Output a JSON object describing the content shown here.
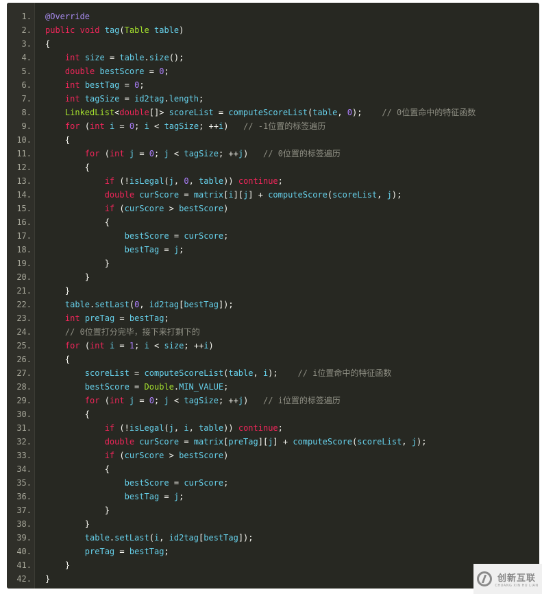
{
  "code": {
    "language": "java",
    "lines": [
      [
        [
          "an",
          "@Override"
        ]
      ],
      [
        [
          "kw",
          "public"
        ],
        [
          "p",
          " "
        ],
        [
          "kw",
          "void"
        ],
        [
          "p",
          " "
        ],
        [
          "id",
          "tag"
        ],
        [
          "p",
          "("
        ],
        [
          "ty",
          "Table"
        ],
        [
          "p",
          " "
        ],
        [
          "id",
          "table"
        ],
        [
          "p",
          ")"
        ]
      ],
      [
        [
          "p",
          "{"
        ]
      ],
      [
        [
          "p",
          "    "
        ],
        [
          "kw",
          "int"
        ],
        [
          "p",
          " "
        ],
        [
          "id",
          "size"
        ],
        [
          "p",
          " = "
        ],
        [
          "id",
          "table"
        ],
        [
          "p",
          "."
        ],
        [
          "id",
          "size"
        ],
        [
          "p",
          "();"
        ]
      ],
      [
        [
          "p",
          "    "
        ],
        [
          "kw",
          "double"
        ],
        [
          "p",
          " "
        ],
        [
          "id",
          "bestScore"
        ],
        [
          "p",
          " = "
        ],
        [
          "num",
          "0"
        ],
        [
          "p",
          ";"
        ]
      ],
      [
        [
          "p",
          "    "
        ],
        [
          "kw",
          "int"
        ],
        [
          "p",
          " "
        ],
        [
          "id",
          "bestTag"
        ],
        [
          "p",
          " = "
        ],
        [
          "num",
          "0"
        ],
        [
          "p",
          ";"
        ]
      ],
      [
        [
          "p",
          "    "
        ],
        [
          "kw",
          "int"
        ],
        [
          "p",
          " "
        ],
        [
          "id",
          "tagSize"
        ],
        [
          "p",
          " = "
        ],
        [
          "id",
          "id2tag"
        ],
        [
          "p",
          "."
        ],
        [
          "id",
          "length"
        ],
        [
          "p",
          ";"
        ]
      ],
      [
        [
          "p",
          "    "
        ],
        [
          "ty",
          "LinkedList"
        ],
        [
          "p",
          "<"
        ],
        [
          "kw",
          "double"
        ],
        [
          "p",
          "[]> "
        ],
        [
          "id",
          "scoreList"
        ],
        [
          "p",
          " = "
        ],
        [
          "id",
          "computeScoreList"
        ],
        [
          "p",
          "("
        ],
        [
          "id",
          "table"
        ],
        [
          "p",
          ", "
        ],
        [
          "num",
          "0"
        ],
        [
          "p",
          ");    "
        ],
        [
          "cm",
          "// 0位置命中的特征函数"
        ]
      ],
      [
        [
          "p",
          "    "
        ],
        [
          "kw",
          "for"
        ],
        [
          "p",
          " ("
        ],
        [
          "kw",
          "int"
        ],
        [
          "p",
          " "
        ],
        [
          "id",
          "i"
        ],
        [
          "p",
          " = "
        ],
        [
          "num",
          "0"
        ],
        [
          "p",
          "; "
        ],
        [
          "id",
          "i"
        ],
        [
          "p",
          " < "
        ],
        [
          "id",
          "tagSize"
        ],
        [
          "p",
          "; ++"
        ],
        [
          "id",
          "i"
        ],
        [
          "p",
          ")   "
        ],
        [
          "cm",
          "// -1位置的标签遍历"
        ]
      ],
      [
        [
          "p",
          "    {"
        ]
      ],
      [
        [
          "p",
          "        "
        ],
        [
          "kw",
          "for"
        ],
        [
          "p",
          " ("
        ],
        [
          "kw",
          "int"
        ],
        [
          "p",
          " "
        ],
        [
          "id",
          "j"
        ],
        [
          "p",
          " = "
        ],
        [
          "num",
          "0"
        ],
        [
          "p",
          "; "
        ],
        [
          "id",
          "j"
        ],
        [
          "p",
          " < "
        ],
        [
          "id",
          "tagSize"
        ],
        [
          "p",
          "; ++"
        ],
        [
          "id",
          "j"
        ],
        [
          "p",
          ")   "
        ],
        [
          "cm",
          "// 0位置的标签遍历"
        ]
      ],
      [
        [
          "p",
          "        {"
        ]
      ],
      [
        [
          "p",
          "            "
        ],
        [
          "kw",
          "if"
        ],
        [
          "p",
          " (!"
        ],
        [
          "id",
          "isLegal"
        ],
        [
          "p",
          "("
        ],
        [
          "id",
          "j"
        ],
        [
          "p",
          ", "
        ],
        [
          "num",
          "0"
        ],
        [
          "p",
          ", "
        ],
        [
          "id",
          "table"
        ],
        [
          "p",
          ")) "
        ],
        [
          "kw",
          "continue"
        ],
        [
          "p",
          ";"
        ]
      ],
      [
        [
          "p",
          "            "
        ],
        [
          "kw",
          "double"
        ],
        [
          "p",
          " "
        ],
        [
          "id",
          "curScore"
        ],
        [
          "p",
          " = "
        ],
        [
          "id",
          "matrix"
        ],
        [
          "p",
          "["
        ],
        [
          "id",
          "i"
        ],
        [
          "p",
          "]["
        ],
        [
          "id",
          "j"
        ],
        [
          "p",
          "] + "
        ],
        [
          "id",
          "computeScore"
        ],
        [
          "p",
          "("
        ],
        [
          "id",
          "scoreList"
        ],
        [
          "p",
          ", "
        ],
        [
          "id",
          "j"
        ],
        [
          "p",
          ");"
        ]
      ],
      [
        [
          "p",
          "            "
        ],
        [
          "kw",
          "if"
        ],
        [
          "p",
          " ("
        ],
        [
          "id",
          "curScore"
        ],
        [
          "p",
          " > "
        ],
        [
          "id",
          "bestScore"
        ],
        [
          "p",
          ")"
        ]
      ],
      [
        [
          "p",
          "            {"
        ]
      ],
      [
        [
          "p",
          "                "
        ],
        [
          "id",
          "bestScore"
        ],
        [
          "p",
          " = "
        ],
        [
          "id",
          "curScore"
        ],
        [
          "p",
          ";"
        ]
      ],
      [
        [
          "p",
          "                "
        ],
        [
          "id",
          "bestTag"
        ],
        [
          "p",
          " = "
        ],
        [
          "id",
          "j"
        ],
        [
          "p",
          ";"
        ]
      ],
      [
        [
          "p",
          "            }"
        ]
      ],
      [
        [
          "p",
          "        }"
        ]
      ],
      [
        [
          "p",
          "    }"
        ]
      ],
      [
        [
          "p",
          "    "
        ],
        [
          "id",
          "table"
        ],
        [
          "p",
          "."
        ],
        [
          "id",
          "setLast"
        ],
        [
          "p",
          "("
        ],
        [
          "num",
          "0"
        ],
        [
          "p",
          ", "
        ],
        [
          "id",
          "id2tag"
        ],
        [
          "p",
          "["
        ],
        [
          "id",
          "bestTag"
        ],
        [
          "p",
          "]);"
        ]
      ],
      [
        [
          "p",
          "    "
        ],
        [
          "kw",
          "int"
        ],
        [
          "p",
          " "
        ],
        [
          "id",
          "preTag"
        ],
        [
          "p",
          " = "
        ],
        [
          "id",
          "bestTag"
        ],
        [
          "p",
          ";"
        ]
      ],
      [
        [
          "p",
          "    "
        ],
        [
          "cm",
          "// 0位置打分完毕，接下来打剩下的"
        ]
      ],
      [
        [
          "p",
          "    "
        ],
        [
          "kw",
          "for"
        ],
        [
          "p",
          " ("
        ],
        [
          "kw",
          "int"
        ],
        [
          "p",
          " "
        ],
        [
          "id",
          "i"
        ],
        [
          "p",
          " = "
        ],
        [
          "num",
          "1"
        ],
        [
          "p",
          "; "
        ],
        [
          "id",
          "i"
        ],
        [
          "p",
          " < "
        ],
        [
          "id",
          "size"
        ],
        [
          "p",
          "; ++"
        ],
        [
          "id",
          "i"
        ],
        [
          "p",
          ")"
        ]
      ],
      [
        [
          "p",
          "    {"
        ]
      ],
      [
        [
          "p",
          "        "
        ],
        [
          "id",
          "scoreList"
        ],
        [
          "p",
          " = "
        ],
        [
          "id",
          "computeScoreList"
        ],
        [
          "p",
          "("
        ],
        [
          "id",
          "table"
        ],
        [
          "p",
          ", "
        ],
        [
          "id",
          "i"
        ],
        [
          "p",
          ");    "
        ],
        [
          "cm",
          "// i位置命中的特征函数"
        ]
      ],
      [
        [
          "p",
          "        "
        ],
        [
          "id",
          "bestScore"
        ],
        [
          "p",
          " = "
        ],
        [
          "ty",
          "Double"
        ],
        [
          "p",
          "."
        ],
        [
          "id",
          "MIN_VALUE"
        ],
        [
          "p",
          ";"
        ]
      ],
      [
        [
          "p",
          "        "
        ],
        [
          "kw",
          "for"
        ],
        [
          "p",
          " ("
        ],
        [
          "kw",
          "int"
        ],
        [
          "p",
          " "
        ],
        [
          "id",
          "j"
        ],
        [
          "p",
          " = "
        ],
        [
          "num",
          "0"
        ],
        [
          "p",
          "; "
        ],
        [
          "id",
          "j"
        ],
        [
          "p",
          " < "
        ],
        [
          "id",
          "tagSize"
        ],
        [
          "p",
          "; ++"
        ],
        [
          "id",
          "j"
        ],
        [
          "p",
          ")   "
        ],
        [
          "cm",
          "// i位置的标签遍历"
        ]
      ],
      [
        [
          "p",
          "        {"
        ]
      ],
      [
        [
          "p",
          "            "
        ],
        [
          "kw",
          "if"
        ],
        [
          "p",
          " (!"
        ],
        [
          "id",
          "isLegal"
        ],
        [
          "p",
          "("
        ],
        [
          "id",
          "j"
        ],
        [
          "p",
          ", "
        ],
        [
          "id",
          "i"
        ],
        [
          "p",
          ", "
        ],
        [
          "id",
          "table"
        ],
        [
          "p",
          ")) "
        ],
        [
          "kw",
          "continue"
        ],
        [
          "p",
          ";"
        ]
      ],
      [
        [
          "p",
          "            "
        ],
        [
          "kw",
          "double"
        ],
        [
          "p",
          " "
        ],
        [
          "id",
          "curScore"
        ],
        [
          "p",
          " = "
        ],
        [
          "id",
          "matrix"
        ],
        [
          "p",
          "["
        ],
        [
          "id",
          "preTag"
        ],
        [
          "p",
          "]["
        ],
        [
          "id",
          "j"
        ],
        [
          "p",
          "] + "
        ],
        [
          "id",
          "computeScore"
        ],
        [
          "p",
          "("
        ],
        [
          "id",
          "scoreList"
        ],
        [
          "p",
          ", "
        ],
        [
          "id",
          "j"
        ],
        [
          "p",
          ");"
        ]
      ],
      [
        [
          "p",
          "            "
        ],
        [
          "kw",
          "if"
        ],
        [
          "p",
          " ("
        ],
        [
          "id",
          "curScore"
        ],
        [
          "p",
          " > "
        ],
        [
          "id",
          "bestScore"
        ],
        [
          "p",
          ")"
        ]
      ],
      [
        [
          "p",
          "            {"
        ]
      ],
      [
        [
          "p",
          "                "
        ],
        [
          "id",
          "bestScore"
        ],
        [
          "p",
          " = "
        ],
        [
          "id",
          "curScore"
        ],
        [
          "p",
          ";"
        ]
      ],
      [
        [
          "p",
          "                "
        ],
        [
          "id",
          "bestTag"
        ],
        [
          "p",
          " = "
        ],
        [
          "id",
          "j"
        ],
        [
          "p",
          ";"
        ]
      ],
      [
        [
          "p",
          "            }"
        ]
      ],
      [
        [
          "p",
          "        }"
        ]
      ],
      [
        [
          "p",
          "        "
        ],
        [
          "id",
          "table"
        ],
        [
          "p",
          "."
        ],
        [
          "id",
          "setLast"
        ],
        [
          "p",
          "("
        ],
        [
          "id",
          "i"
        ],
        [
          "p",
          ", "
        ],
        [
          "id",
          "id2tag"
        ],
        [
          "p",
          "["
        ],
        [
          "id",
          "bestTag"
        ],
        [
          "p",
          "]);"
        ]
      ],
      [
        [
          "p",
          "        "
        ],
        [
          "id",
          "preTag"
        ],
        [
          "p",
          " = "
        ],
        [
          "id",
          "bestTag"
        ],
        [
          "p",
          ";"
        ]
      ],
      [
        [
          "p",
          "    }"
        ]
      ],
      [
        [
          "p",
          "}"
        ]
      ]
    ]
  },
  "watermark": {
    "logo_icon": "chuangxin-logo-icon",
    "text_cn": "创新互联",
    "text_en": "CHUANG XIN HU LIAN"
  },
  "colors": {
    "background": "#272822",
    "gutter": "#2f2f29",
    "keyword": "#f0265a",
    "identifier": "#66d0ea",
    "type": "#a6e22e",
    "number": "#ae81ff",
    "annotation": "#a88cf0",
    "comment": "#8f8f84"
  }
}
